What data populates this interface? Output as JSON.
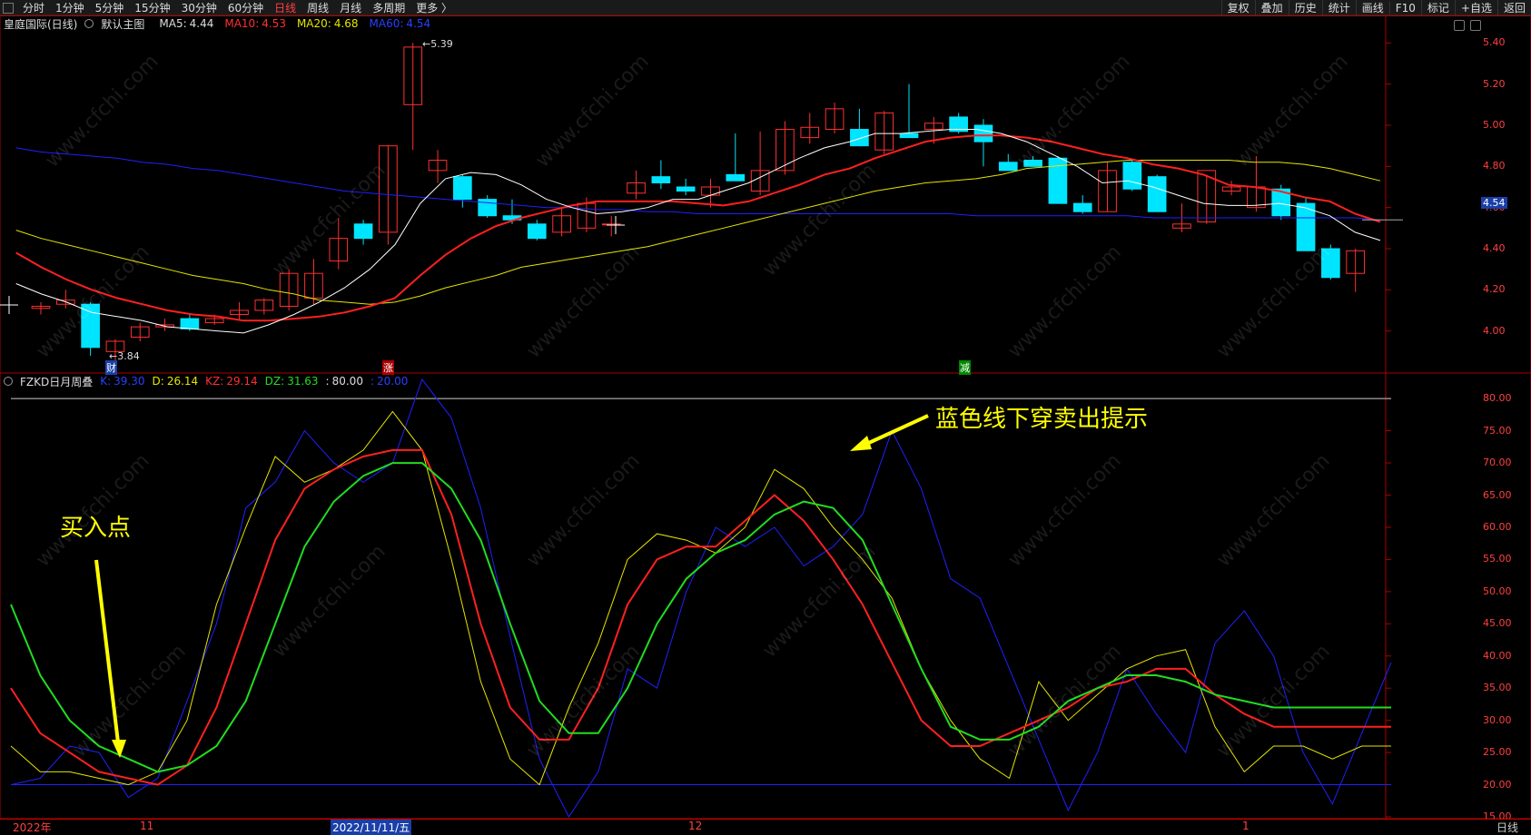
{
  "toolbar": {
    "left": [
      "分时",
      "1分钟",
      "5分钟",
      "15分钟",
      "30分钟",
      "60分钟",
      "日线",
      "周线",
      "月线",
      "多周期",
      "更多 〉"
    ],
    "active": "日线",
    "right": [
      "复权",
      "叠加",
      "历史",
      "统计",
      "画线",
      "F10",
      "标记",
      "+自选",
      "返回"
    ]
  },
  "main": {
    "title": "皇庭国际(日线)",
    "indicator": "默认主图",
    "ma5_label": "MA5:",
    "ma5": "4.44",
    "ma10_label": "MA10:",
    "ma10": "4.53",
    "ma20_label": "MA20:",
    "ma20": "4.68",
    "ma60_label": "MA60:",
    "ma60": "4.54",
    "high_label": "5.39",
    "low_label": "3.84",
    "current_price": "4.54",
    "price_ticks": [
      "5.40",
      "5.20",
      "5.00",
      "4.80",
      "4.60",
      "4.40",
      "4.20",
      "4.00"
    ],
    "markers": [
      "财",
      "涨",
      "减"
    ]
  },
  "sub": {
    "title": "FZKD日月周叠",
    "k_label": "K:",
    "k": "39.30",
    "d_label": "D:",
    "d": "26.14",
    "kz_label": "KZ:",
    "kz": "29.14",
    "dz_label": "DZ:",
    "dz": "31.63",
    "h_label": ":",
    "h": "80.00",
    "l_label": ":",
    "l": "20.00",
    "ticks": [
      "80.00",
      "75.00",
      "70.00",
      "65.00",
      "60.00",
      "55.00",
      "50.00",
      "45.00",
      "40.00",
      "35.00",
      "30.00",
      "25.00",
      "20.00",
      "15.00"
    ]
  },
  "annotations": {
    "sell": "蓝色线下穿卖出提示",
    "buy": "买入点"
  },
  "dates": [
    "2022年",
    "11",
    "2022/11/11/五",
    "12",
    "1"
  ],
  "period": "日线",
  "watermark": "www.cfchi.com",
  "colors": {
    "up": "#ff3030",
    "down": "#00e5ff",
    "ma5": "#ffffff",
    "ma10": "#ff2020",
    "ma20": "#e5e500",
    "ma60": "#2020ff",
    "k": "#2020ff",
    "d": "#e5e500",
    "kz": "#ff2020",
    "dz": "#20dd20"
  },
  "chart_data": [
    {
      "type": "candlestick",
      "ylim": [
        3.8,
        5.45
      ],
      "candles": [
        [
          4.11,
          4.14,
          4.08,
          4.12
        ],
        [
          4.13,
          4.2,
          4.11,
          4.15
        ],
        [
          4.13,
          4.14,
          3.88,
          3.92
        ],
        [
          3.9,
          3.96,
          3.84,
          3.95
        ],
        [
          3.97,
          4.04,
          3.95,
          4.02
        ],
        [
          4.02,
          4.06,
          4.0,
          4.03
        ],
        [
          4.06,
          4.08,
          4.0,
          4.01
        ],
        [
          4.04,
          4.08,
          4.03,
          4.06
        ],
        [
          4.08,
          4.14,
          4.05,
          4.1
        ],
        [
          4.1,
          4.16,
          4.08,
          4.15
        ],
        [
          4.12,
          4.3,
          4.1,
          4.28
        ],
        [
          4.16,
          4.35,
          4.13,
          4.28
        ],
        [
          4.34,
          4.55,
          4.3,
          4.45
        ],
        [
          4.52,
          4.54,
          4.42,
          4.45
        ],
        [
          4.48,
          4.9,
          4.42,
          4.9
        ],
        [
          5.1,
          5.4,
          4.88,
          5.38
        ],
        [
          4.78,
          4.88,
          4.72,
          4.83
        ],
        [
          4.75,
          4.76,
          4.6,
          4.64
        ],
        [
          4.64,
          4.66,
          4.55,
          4.56
        ],
        [
          4.56,
          4.64,
          4.52,
          4.54
        ],
        [
          4.52,
          4.54,
          4.44,
          4.45
        ],
        [
          4.48,
          4.6,
          4.46,
          4.56
        ],
        [
          4.5,
          4.65,
          4.48,
          4.62
        ],
        [
          4.52,
          4.56,
          4.46,
          4.52
        ],
        [
          4.67,
          4.78,
          4.64,
          4.72
        ],
        [
          4.75,
          4.83,
          4.69,
          4.72
        ],
        [
          4.7,
          4.74,
          4.66,
          4.68
        ],
        [
          4.66,
          4.74,
          4.6,
          4.7
        ],
        [
          4.76,
          4.96,
          4.73,
          4.73
        ],
        [
          4.68,
          4.97,
          4.66,
          4.78
        ],
        [
          4.78,
          5.02,
          4.76,
          4.98
        ],
        [
          4.94,
          5.06,
          4.91,
          4.99
        ],
        [
          4.98,
          5.11,
          4.96,
          5.08
        ],
        [
          4.98,
          5.08,
          4.9,
          4.9
        ],
        [
          4.88,
          5.07,
          4.86,
          5.06
        ],
        [
          4.96,
          5.2,
          4.95,
          4.94
        ],
        [
          4.98,
          5.04,
          4.91,
          5.01
        ],
        [
          5.04,
          5.06,
          4.96,
          4.97
        ],
        [
          5.0,
          5.03,
          4.8,
          4.92
        ],
        [
          4.82,
          4.86,
          4.78,
          4.78
        ],
        [
          4.83,
          4.85,
          4.8,
          4.8
        ],
        [
          4.84,
          4.85,
          4.62,
          4.62
        ],
        [
          4.62,
          4.66,
          4.57,
          4.58
        ],
        [
          4.58,
          4.82,
          4.58,
          4.78
        ],
        [
          4.82,
          4.83,
          4.68,
          4.69
        ],
        [
          4.75,
          4.76,
          4.58,
          4.58
        ],
        [
          4.5,
          4.62,
          4.48,
          4.52
        ],
        [
          4.53,
          4.76,
          4.52,
          4.78
        ],
        [
          4.68,
          4.73,
          4.66,
          4.7
        ],
        [
          4.6,
          4.85,
          4.58,
          4.7
        ],
        [
          4.69,
          4.71,
          4.54,
          4.56
        ],
        [
          4.62,
          4.65,
          4.4,
          4.39
        ],
        [
          4.4,
          4.42,
          4.25,
          4.26
        ],
        [
          4.28,
          4.4,
          4.19,
          4.39
        ]
      ],
      "ma5": [
        4.23,
        4.18,
        4.14,
        4.09,
        4.07,
        4.05,
        4.02,
        4.01,
        4.0,
        3.99,
        4.03,
        4.08,
        4.14,
        4.21,
        4.3,
        4.42,
        4.62,
        4.74,
        4.77,
        4.76,
        4.71,
        4.64,
        4.6,
        4.57,
        4.58,
        4.6,
        4.64,
        4.64,
        4.68,
        4.72,
        4.78,
        4.84,
        4.89,
        4.92,
        4.96,
        4.96,
        4.97,
        4.98,
        4.98,
        4.96,
        4.92,
        4.86,
        4.8,
        4.72,
        4.73,
        4.7,
        4.66,
        4.62,
        4.61,
        4.61,
        4.62,
        4.6,
        4.56,
        4.48,
        4.44
      ],
      "ma10": [
        4.38,
        4.31,
        4.25,
        4.2,
        4.16,
        4.13,
        4.1,
        4.08,
        4.07,
        4.05,
        4.05,
        4.06,
        4.07,
        4.09,
        4.12,
        4.16,
        4.27,
        4.37,
        4.45,
        4.51,
        4.55,
        4.58,
        4.61,
        4.63,
        4.63,
        4.63,
        4.63,
        4.62,
        4.61,
        4.63,
        4.67,
        4.71,
        4.76,
        4.79,
        4.84,
        4.88,
        4.92,
        4.94,
        4.95,
        4.95,
        4.94,
        4.92,
        4.89,
        4.86,
        4.84,
        4.81,
        4.79,
        4.76,
        4.71,
        4.7,
        4.68,
        4.65,
        4.63,
        4.57,
        4.53
      ],
      "ma20": [
        4.49,
        4.45,
        4.42,
        4.39,
        4.36,
        4.33,
        4.3,
        4.27,
        4.25,
        4.23,
        4.2,
        4.18,
        4.15,
        4.14,
        4.13,
        4.14,
        4.17,
        4.21,
        4.24,
        4.27,
        4.31,
        4.33,
        4.35,
        4.37,
        4.39,
        4.41,
        4.44,
        4.47,
        4.5,
        4.53,
        4.56,
        4.59,
        4.62,
        4.65,
        4.68,
        4.7,
        4.72,
        4.73,
        4.74,
        4.76,
        4.79,
        4.8,
        4.81,
        4.82,
        4.83,
        4.83,
        4.83,
        4.83,
        4.83,
        4.82,
        4.82,
        4.81,
        4.79,
        4.76,
        4.73
      ],
      "ma60": [
        4.89,
        4.87,
        4.86,
        4.85,
        4.84,
        4.82,
        4.81,
        4.79,
        4.78,
        4.76,
        4.74,
        4.72,
        4.7,
        4.68,
        4.67,
        4.66,
        4.65,
        4.64,
        4.63,
        4.62,
        4.61,
        4.6,
        4.6,
        4.59,
        4.59,
        4.58,
        4.58,
        4.57,
        4.57,
        4.57,
        4.57,
        4.57,
        4.57,
        4.57,
        4.57,
        4.57,
        4.57,
        4.57,
        4.56,
        4.56,
        4.56,
        4.56,
        4.56,
        4.56,
        4.56,
        4.55,
        4.55,
        4.55,
        4.55,
        4.55,
        4.55,
        4.55,
        4.55,
        4.55,
        4.54
      ]
    },
    {
      "type": "line",
      "ylim": [
        15,
        82
      ],
      "series": [
        {
          "name": "K",
          "values": [
            20,
            21,
            26,
            25,
            18,
            21,
            33,
            45,
            63,
            67,
            75,
            70,
            67,
            70,
            83,
            77,
            63,
            43,
            24,
            15,
            22,
            38,
            35,
            50,
            60,
            57,
            60,
            54,
            57,
            62,
            75,
            66,
            52,
            49,
            38,
            27,
            16,
            25,
            38,
            31,
            25,
            42,
            47,
            40,
            25,
            17,
            28,
            39
          ]
        },
        {
          "name": "D",
          "values": [
            26,
            22,
            22,
            21,
            20,
            22,
            30,
            48,
            60,
            71,
            67,
            69,
            72,
            78,
            72,
            55,
            36,
            24,
            20,
            32,
            42,
            55,
            59,
            58,
            56,
            60,
            69,
            66,
            60,
            55,
            49,
            38,
            30,
            24,
            21,
            36,
            30,
            34,
            38,
            40,
            41,
            29,
            22,
            26,
            26,
            24,
            26,
            26
          ]
        },
        {
          "name": "KZ",
          "values": [
            35,
            28,
            25,
            22,
            21,
            20,
            23,
            32,
            45,
            58,
            66,
            69,
            71,
            72,
            72,
            62,
            45,
            32,
            27,
            27,
            35,
            48,
            55,
            57,
            57,
            61,
            65,
            61,
            55,
            48,
            39,
            30,
            26,
            26,
            28,
            30,
            32,
            35,
            36,
            38,
            38,
            34,
            31,
            29,
            29,
            29,
            29,
            29
          ]
        },
        {
          "name": "DZ",
          "values": [
            48,
            37,
            30,
            26,
            24,
            22,
            23,
            26,
            33,
            45,
            57,
            64,
            68,
            70,
            70,
            66,
            58,
            45,
            33,
            28,
            28,
            35,
            45,
            52,
            56,
            58,
            62,
            64,
            63,
            58,
            48,
            38,
            29,
            27,
            27,
            29,
            33,
            35,
            37,
            37,
            36,
            34,
            33,
            32,
            32,
            32,
            32,
            32
          ]
        }
      ],
      "hlines": [
        80,
        20
      ]
    }
  ]
}
